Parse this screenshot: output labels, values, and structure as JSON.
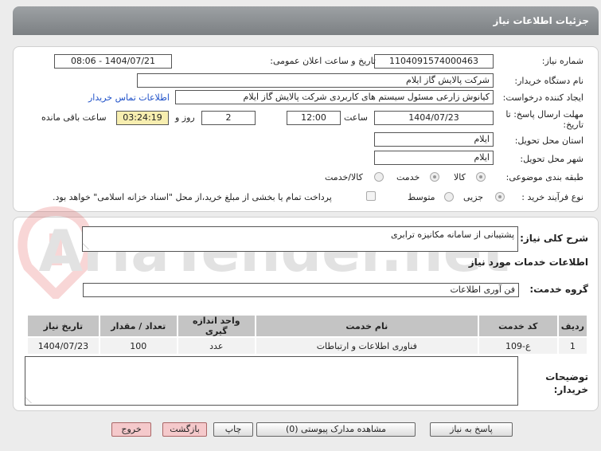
{
  "header": {
    "title": "جزئیات اطلاعات نیاز"
  },
  "form": {
    "need_number_label": "شماره نیاز:",
    "need_number": "1104091574000463",
    "announce_label": "تاریخ و ساعت اعلان عمومی:",
    "announce_value": "1404/07/21 - 08:06",
    "buyer_org_label": "نام دستگاه خریدار:",
    "buyer_org": "شرکت پالایش گاز ایلام",
    "creator_label": "ایجاد کننده درخواست:",
    "creator": "کیانوش زارعی مسئول سیستم های کاربردی شرکت پالایش گاز ایلام",
    "contact_link": "اطلاعات تماس خریدار",
    "deadline_label": "مهلت ارسال پاسخ: تا تاریخ:",
    "deadline_date": "1404/07/23",
    "time_label": "ساعت",
    "deadline_time": "12:00",
    "days_value": "2",
    "days_label": "روز و",
    "remaining_time": "03:24:19",
    "remaining_label": "ساعت باقی مانده",
    "province_label": "استان محل تحویل:",
    "province": "ایلام",
    "city_label": "شهر محل تحویل:",
    "city": "ایلام",
    "category_label": "طبقه بندی موضوعی:",
    "category_options": [
      "کالا",
      "خدمت",
      "کالا/خدمت"
    ],
    "process_label": "نوع فرآیند خرید :",
    "process_options": [
      "جزیی",
      "متوسط"
    ],
    "payment_note": "پرداخت تمام یا بخشی از مبلغ خرید،از محل \"اسناد خزانه اسلامی\" خواهد بود."
  },
  "description": {
    "label": "شرح کلی نیاز:",
    "value": "پشتیبانی از سامانه مکانیزه ترابری"
  },
  "services": {
    "section_title": "اطلاعات خدمات مورد نیاز",
    "group_label": "گروه خدمت:",
    "group_value": "فن آوری اطلاعات",
    "columns": [
      "ردیف",
      "کد خدمت",
      "نام خدمت",
      "واحد اندازه گیری",
      "تعداد / مقدار",
      "تاریخ نیاز"
    ],
    "rows": [
      [
        "1",
        "ع-109",
        "فناوری اطلاعات و ارتباطات",
        "عدد",
        "100",
        "1404/07/23"
      ]
    ]
  },
  "buyer_notes": {
    "label": "توضیحات خریدار:"
  },
  "buttons": {
    "reply": "پاسخ به نیاز",
    "attachments": "مشاهده مدارک پیوستی (0)",
    "print": "چاپ",
    "back": "بازگشت",
    "exit": "خروج"
  },
  "watermark": {
    "text": "AriaTender.net"
  }
}
